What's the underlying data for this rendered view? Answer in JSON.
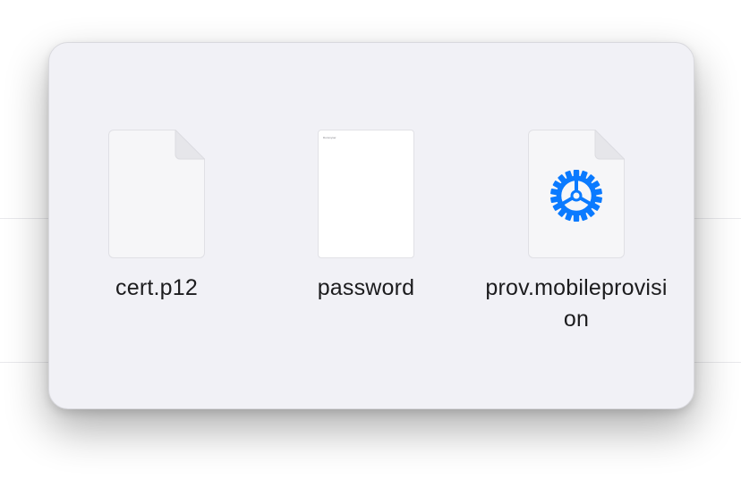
{
  "files": [
    {
      "name": "cert.p12",
      "kind": "generic-document",
      "icon": "blank-document-icon"
    },
    {
      "name": "password",
      "kind": "text-preview",
      "icon": "text-preview-thumbnail",
      "preview_text": "Dummyser"
    },
    {
      "name": "prov.mobileprovision",
      "kind": "provisioning-profile",
      "icon": "gear-icon",
      "icon_color": "#0a7aff"
    }
  ],
  "colors": {
    "card_background": "#f1f1f6",
    "label_text": "#1c1c1e",
    "accent": "#0a7aff"
  }
}
